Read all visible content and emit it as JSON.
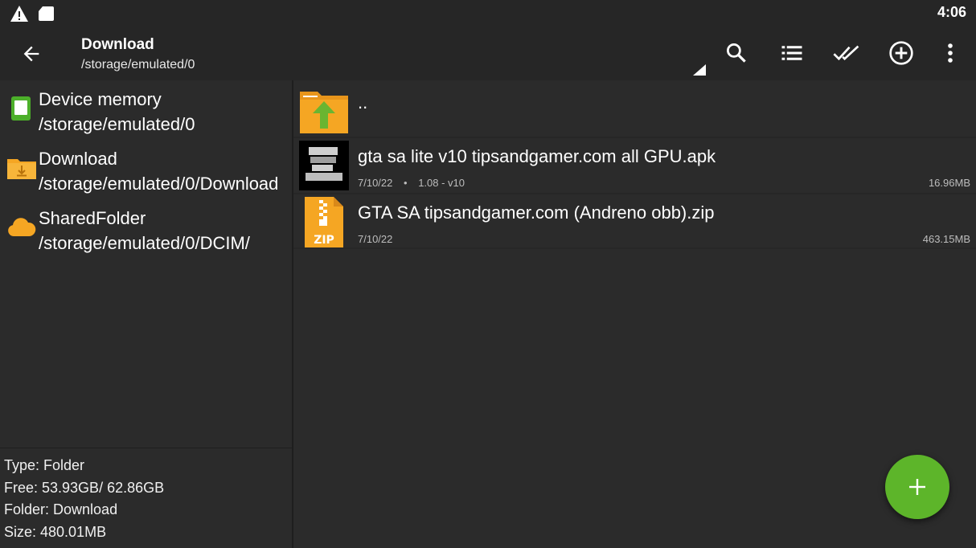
{
  "status_bar": {
    "time": "4:06",
    "icons": [
      "warning-icon",
      "sd-card-icon"
    ]
  },
  "toolbar": {
    "title": "Download",
    "subtitle": "/storage/emulated/0",
    "actions": [
      "search-icon",
      "list-view-icon",
      "select-all-icon",
      "add-circle-icon",
      "more-vert-icon"
    ]
  },
  "bookmarks": [
    {
      "title": "Device memory",
      "path": "/storage/emulated/0",
      "icon": "phone-storage-icon"
    },
    {
      "title": "Download",
      "path": "/storage/emulated/0/Download",
      "icon": "download-folder-icon"
    },
    {
      "title": "SharedFolder",
      "path": "/storage/emulated/0/DCIM/",
      "icon": "cloud-icon"
    }
  ],
  "info": {
    "type": "Type: Folder",
    "free": "Free: 53.93GB/ 62.86GB",
    "folder": "Folder: Download",
    "size": "Size: 480.01MB"
  },
  "files": [
    {
      "name": "..",
      "icon": "folder-up-icon"
    },
    {
      "name": "gta sa lite v10 tipsandgamer.com all GPU.apk",
      "date": "7/10/22",
      "bullet": "•",
      "version": "1.08 - v10",
      "size": "16.96MB",
      "icon": "apk-thumbnail-icon"
    },
    {
      "name": "GTA SA tipsandgamer.com (Andreno obb).zip",
      "date": "7/10/22",
      "size": "463.15MB",
      "icon": "zip-file-icon",
      "icon_label": "ZIP"
    }
  ],
  "fab": {
    "icon": "plus-icon"
  },
  "colors": {
    "accent": "#5db52a",
    "folder": "#f5a623",
    "background": "#2b2b2b",
    "toolbar": "#262626"
  }
}
